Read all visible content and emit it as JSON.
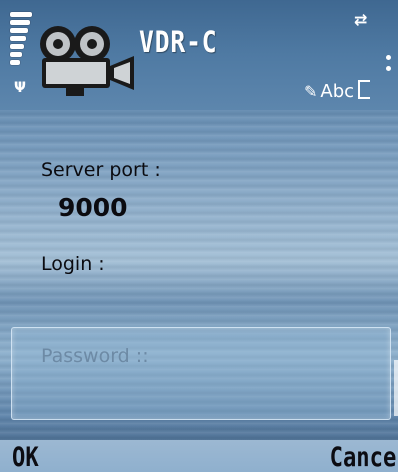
{
  "status_bar": {
    "signal_icon": "signal-strength-icon",
    "antenna_symbol": "Ψ",
    "connectivity_symbol": "⇄"
  },
  "header": {
    "app_icon": "movie-camera-icon",
    "title": "VDR-C",
    "input_mode": "Abc"
  },
  "form": {
    "server_port_label": "Server port :",
    "server_port_value": "9000",
    "login_label": "Login :",
    "password_label": "Password ::"
  },
  "softkeys": {
    "left": "OK",
    "right": "Cance"
  },
  "colors": {
    "header_blue": "#4f7aa3",
    "label_text": "#0b0b10",
    "placeholder_text": "#6d8aa5"
  }
}
